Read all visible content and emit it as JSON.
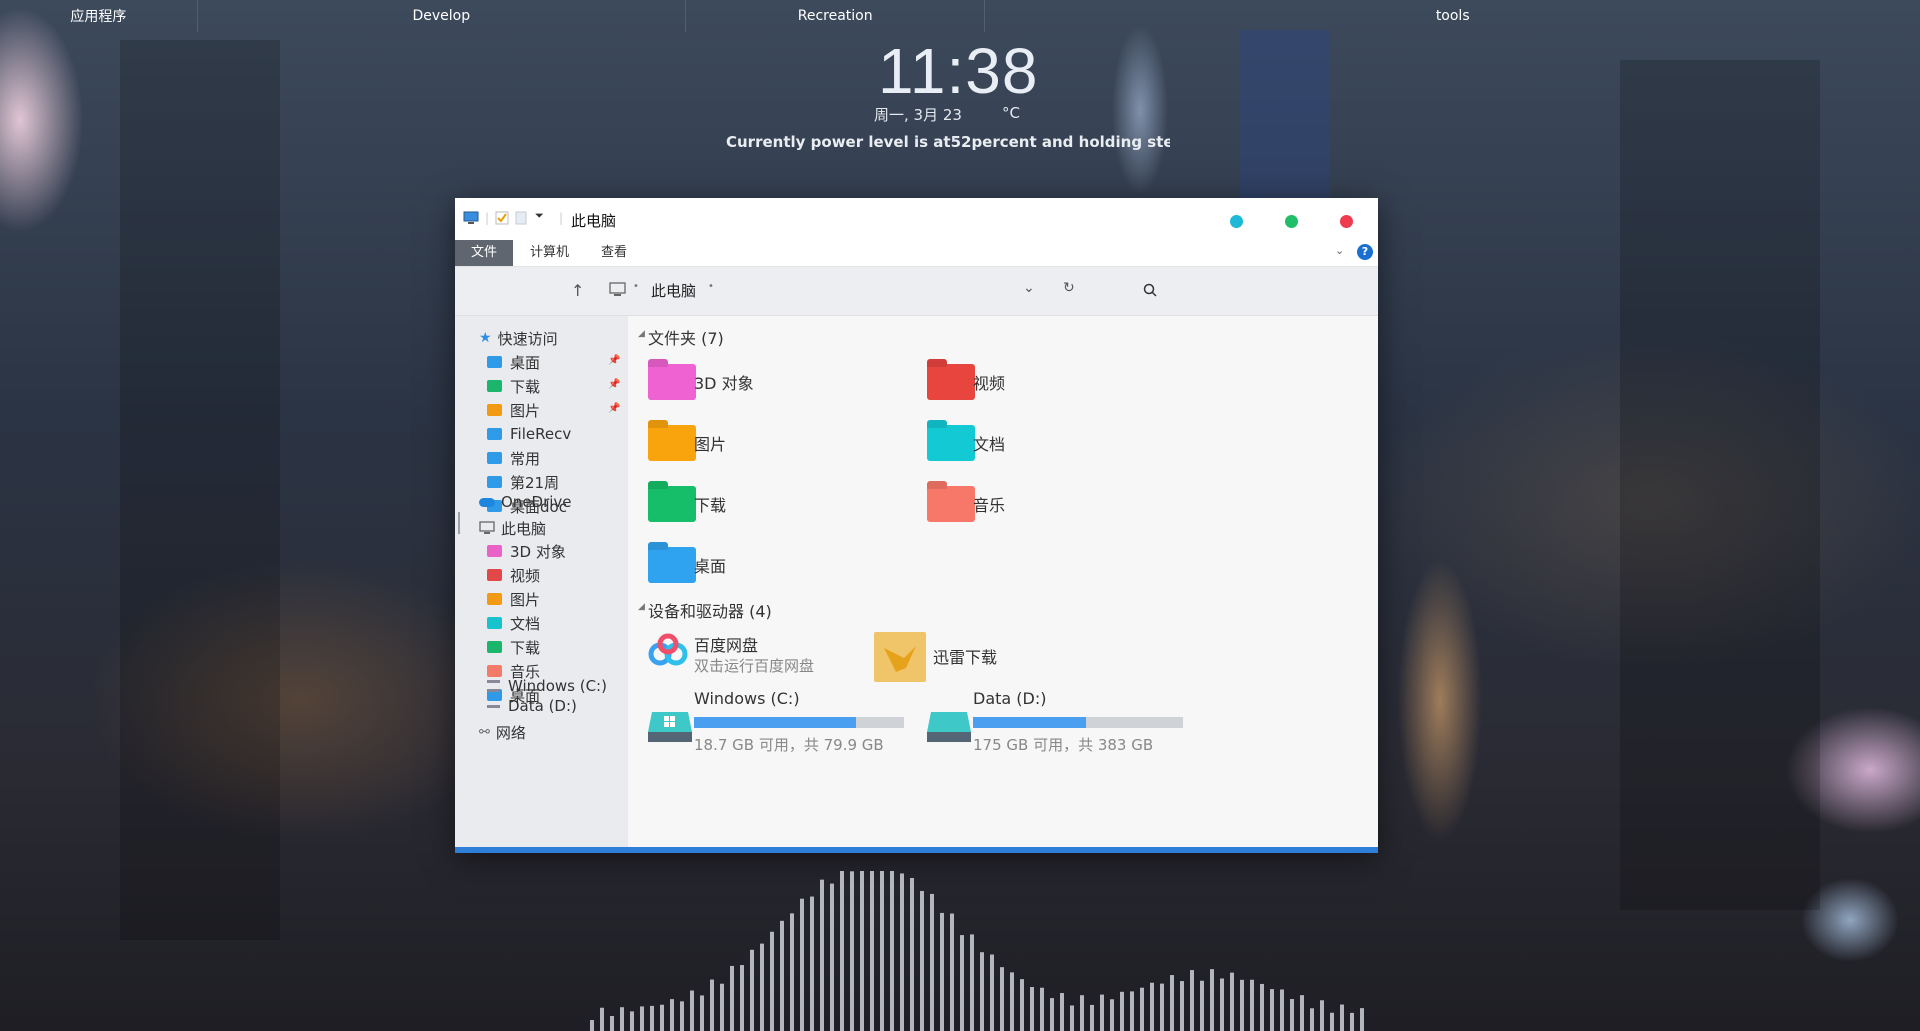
{
  "taskbar": {
    "groups": [
      "应用程序",
      "Develop",
      "Recreation",
      "tools"
    ]
  },
  "widget": {
    "time": "11:38",
    "date": "周一, 3月 23",
    "temp_unit": "°C",
    "power_prefix": "Currently power level is at",
    "power_value": "52",
    "power_suffix": "percent and holding ste"
  },
  "explorer": {
    "title": "此电脑",
    "ribbon_tabs": [
      "文件",
      "计算机",
      "查看"
    ],
    "address": "此电脑",
    "window_dot_colors": [
      "#1fb8d6",
      "#1fbf6a",
      "#ee3b4f"
    ],
    "nav": {
      "quick_access": "快速访问",
      "quick_items": [
        {
          "label": "桌面",
          "color": "#2f9be8",
          "pinned": true
        },
        {
          "label": "下载",
          "color": "#1bb56c",
          "pinned": true
        },
        {
          "label": "图片",
          "color": "#f29a14",
          "pinned": true
        },
        {
          "label": "FileRecv",
          "color": "#2f9be8",
          "pinned": false
        },
        {
          "label": "常用",
          "color": "#2f9be8",
          "pinned": false
        },
        {
          "label": "第21周",
          "color": "#2f9be8",
          "pinned": false
        },
        {
          "label": "桌面doc",
          "color": "#2f9be8",
          "pinned": false
        }
      ],
      "onedrive": "OneDrive",
      "this_pc": "此电脑",
      "pc_items": [
        {
          "label": "3D 对象",
          "color": "#e862c8"
        },
        {
          "label": "视频",
          "color": "#e24848"
        },
        {
          "label": "图片",
          "color": "#f29a14"
        },
        {
          "label": "文档",
          "color": "#17c3cc"
        },
        {
          "label": "下载",
          "color": "#1bb56c"
        },
        {
          "label": "音乐",
          "color": "#f47a6a"
        },
        {
          "label": "桌面",
          "color": "#2f9be8"
        }
      ],
      "drives": [
        "Windows (C:)",
        "Data (D:)"
      ],
      "network": "网络"
    },
    "folders_header": "文件夹 (7)",
    "folders": [
      {
        "label": "3D 对象",
        "color": "#ef62d2"
      },
      {
        "label": "视频",
        "color": "#e8453f"
      },
      {
        "label": "图片",
        "color": "#f9a40c"
      },
      {
        "label": "文档",
        "color": "#12c9d4"
      },
      {
        "label": "下载",
        "color": "#16be6a"
      },
      {
        "label": "音乐",
        "color": "#f77868"
      },
      {
        "label": "桌面",
        "color": "#2fa3ef"
      }
    ],
    "devices_header": "设备和驱动器 (4)",
    "apps": [
      {
        "label": "百度网盘",
        "sub": "双击运行百度网盘"
      },
      {
        "label": "迅雷下载",
        "sub": ""
      }
    ],
    "drives": [
      {
        "label": "Windows (C:)",
        "info": "18.7 GB 可用，共 79.9 GB",
        "used_fraction": 0.77
      },
      {
        "label": "Data (D:)",
        "info": "175 GB 可用，共 383 GB",
        "used_fraction": 0.54
      }
    ]
  }
}
